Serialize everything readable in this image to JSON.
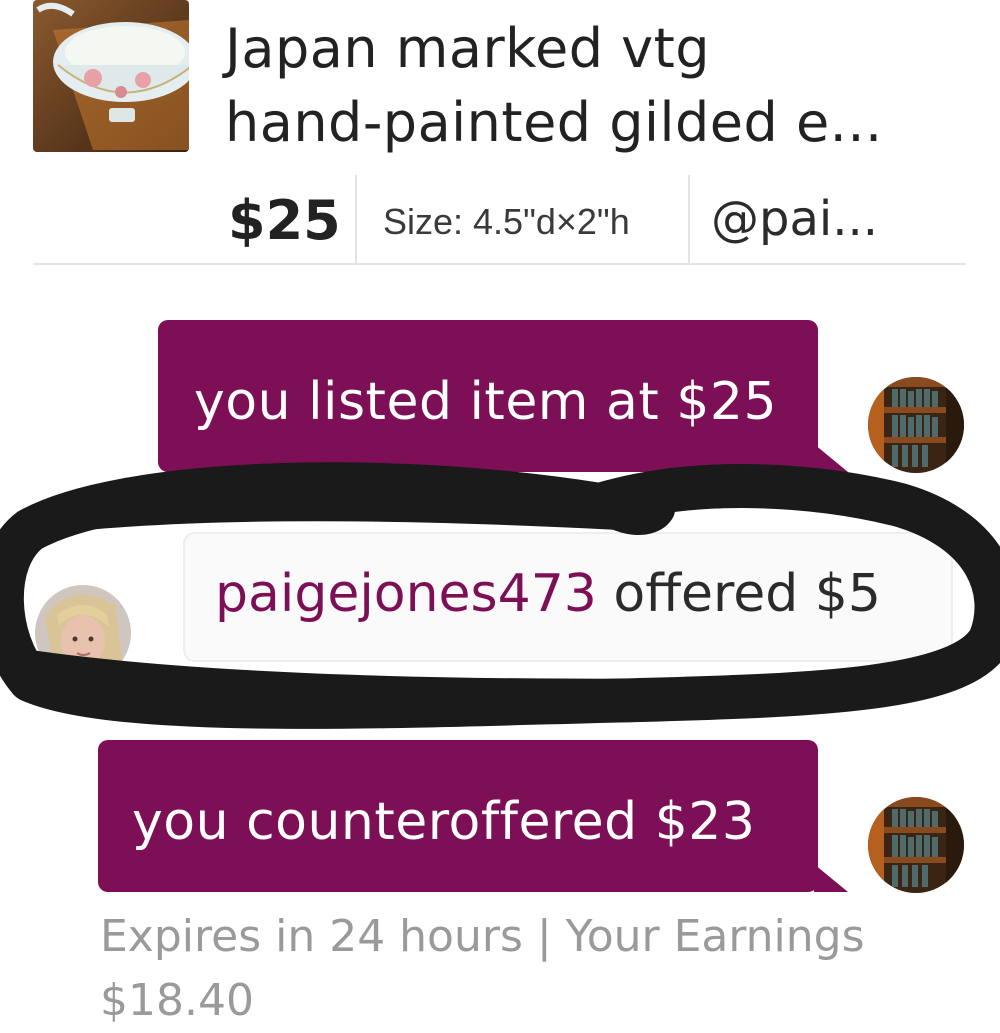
{
  "listing": {
    "thumbnail_alt": "hand-painted gilded bowl",
    "title_line1": "Japan marked vtg",
    "title_line2": "hand-painted gilded  e...",
    "price": "$25",
    "size": "Size: 4.5\"d×2\"h",
    "seller": "@pai..."
  },
  "messages": [
    {
      "type": "outgoing",
      "text": "you listed item at $25"
    },
    {
      "type": "incoming",
      "username": "paigejones473",
      "text": " offered $5"
    },
    {
      "type": "outgoing",
      "text": "you counteroffered $23"
    }
  ],
  "footer": {
    "line1": "Expires in 24 hours | Your Earnings",
    "line2": "$18.40"
  },
  "colors": {
    "accent": "#7d0f56",
    "annotation": "#1a1a1a"
  }
}
